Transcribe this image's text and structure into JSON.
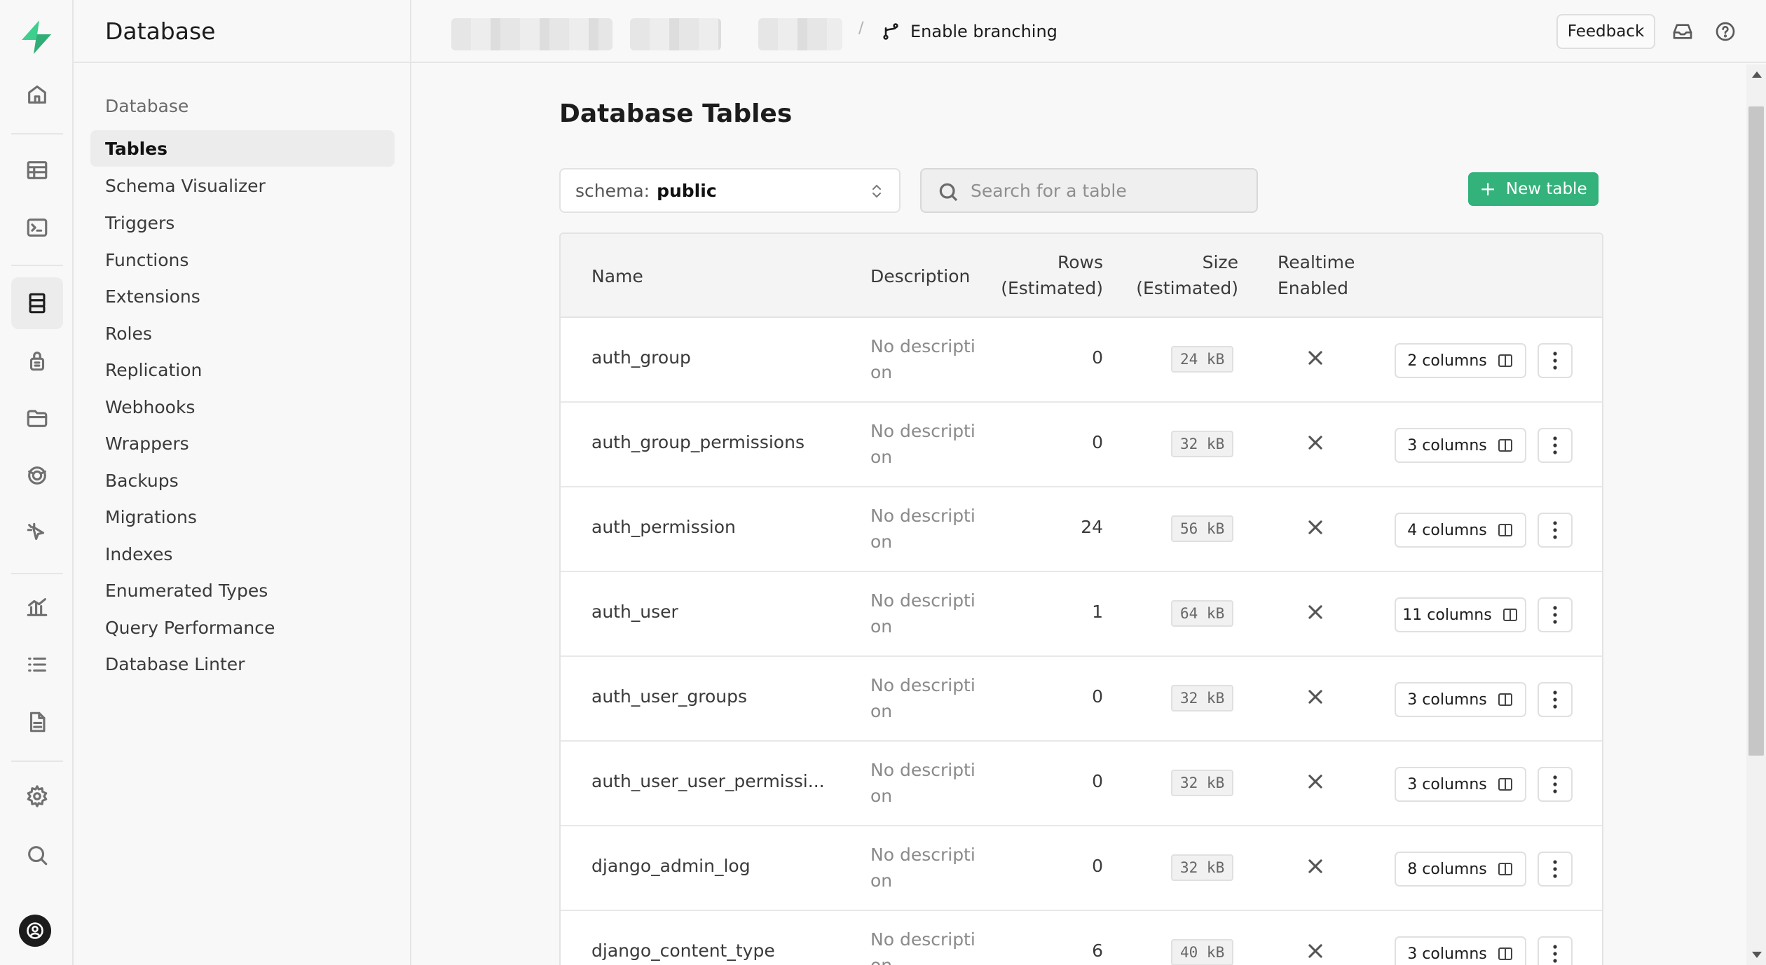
{
  "sidebar": {
    "header": "Database",
    "group_title": "Database",
    "items": [
      {
        "label": "Tables",
        "active": true
      },
      {
        "label": "Schema Visualizer"
      },
      {
        "label": "Triggers"
      },
      {
        "label": "Functions"
      },
      {
        "label": "Extensions"
      },
      {
        "label": "Roles"
      },
      {
        "label": "Replication"
      },
      {
        "label": "Webhooks"
      },
      {
        "label": "Wrappers"
      },
      {
        "label": "Backups"
      },
      {
        "label": "Migrations"
      },
      {
        "label": "Indexes"
      },
      {
        "label": "Enumerated Types"
      },
      {
        "label": "Query Performance"
      },
      {
        "label": "Database Linter"
      }
    ]
  },
  "topbar": {
    "slash": "/",
    "branching_label": "Enable branching",
    "feedback_label": "Feedback"
  },
  "main": {
    "title": "Database Tables",
    "schema": {
      "prefix": "schema:",
      "value": "public"
    },
    "search": {
      "placeholder": "Search for a table"
    },
    "new_table_label": "New table",
    "columns": {
      "name": "Name",
      "description": "Description",
      "rows_line1": "Rows",
      "rows_line2": "(Estimated)",
      "size_line1": "Size",
      "size_line2": "(Estimated)",
      "realtime_line1": "Realtime",
      "realtime_line2": "Enabled"
    },
    "rows": [
      {
        "name": "auth_group",
        "description": "No description",
        "rows": "0",
        "size": "24 kB",
        "realtime": false,
        "columns": "2 columns"
      },
      {
        "name": "auth_group_permissions",
        "description": "No description",
        "rows": "0",
        "size": "32 kB",
        "realtime": false,
        "columns": "3 columns"
      },
      {
        "name": "auth_permission",
        "description": "No description",
        "rows": "24",
        "size": "56 kB",
        "realtime": false,
        "columns": "4 columns"
      },
      {
        "name": "auth_user",
        "description": "No description",
        "rows": "1",
        "size": "64 kB",
        "realtime": false,
        "columns": "11 columns"
      },
      {
        "name": "auth_user_groups",
        "description": "No description",
        "rows": "0",
        "size": "32 kB",
        "realtime": false,
        "columns": "3 columns"
      },
      {
        "name": "auth_user_user_permissi...",
        "description": "No description",
        "rows": "0",
        "size": "32 kB",
        "realtime": false,
        "columns": "3 columns"
      },
      {
        "name": "django_admin_log",
        "description": "No description",
        "rows": "0",
        "size": "32 kB",
        "realtime": false,
        "columns": "8 columns"
      },
      {
        "name": "django_content_type",
        "description": "No description",
        "rows": "6",
        "size": "40 kB",
        "realtime": false,
        "columns": "3 columns"
      }
    ]
  },
  "rail_icons": [
    "home-icon",
    "table-editor-icon",
    "sql-editor-icon",
    "database-icon",
    "auth-icon",
    "storage-icon",
    "realtime-icon",
    "edge-functions-icon",
    "reports-icon",
    "logs-icon",
    "docs-icon",
    "settings-icon",
    "search-icon"
  ],
  "colors": {
    "brand": "#34b27b",
    "accent_logo": "#3ecf8e"
  }
}
